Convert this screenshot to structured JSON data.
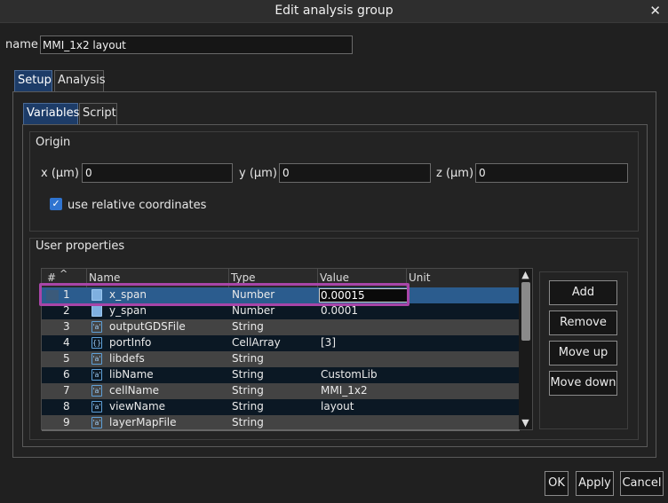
{
  "window": {
    "title": "Edit analysis group",
    "close_glyph": "✕"
  },
  "name_field": {
    "label": "name",
    "value": "MMI_1x2 layout"
  },
  "outer_tabs": [
    {
      "label": "Setup",
      "active": true
    },
    {
      "label": "Analysis",
      "active": false
    }
  ],
  "inner_tabs": [
    {
      "label": "Variables",
      "active": true
    },
    {
      "label": "Script",
      "active": false
    }
  ],
  "origin": {
    "title": "Origin",
    "x_label": "x (µm)",
    "x_value": "0",
    "y_label": "y (µm)",
    "y_value": "0",
    "z_label": "z (µm)",
    "z_value": "0",
    "relative_label": "use relative coordinates",
    "relative_checked": true
  },
  "user_properties": {
    "title": "User properties",
    "columns": {
      "num": "#",
      "name": "Name",
      "type": "Type",
      "value": "Value",
      "unit": "Unit"
    },
    "rows": [
      {
        "num": "1",
        "icon": "number-icon",
        "name": "x_span",
        "type": "Number",
        "value": "0.00015",
        "selected": true,
        "editing": true
      },
      {
        "num": "2",
        "icon": "number-icon",
        "name": "y_span",
        "type": "Number",
        "value": "0.0001"
      },
      {
        "num": "3",
        "icon": "string-icon",
        "name": "outputGDSFile",
        "type": "String",
        "value": ""
      },
      {
        "num": "4",
        "icon": "cellarray-icon",
        "name": "portInfo",
        "type": "CellArray",
        "value": "[3]"
      },
      {
        "num": "5",
        "icon": "string-icon",
        "name": "libdefs",
        "type": "String",
        "value": ""
      },
      {
        "num": "6",
        "icon": "string-icon",
        "name": "libName",
        "type": "String",
        "value": "CustomLib"
      },
      {
        "num": "7",
        "icon": "string-icon",
        "name": "cellName",
        "type": "String",
        "value": "MMI_1x2"
      },
      {
        "num": "8",
        "icon": "string-icon",
        "name": "viewName",
        "type": "String",
        "value": "layout"
      },
      {
        "num": "9",
        "icon": "string-icon",
        "name": "layerMapFile",
        "type": "String",
        "value": ""
      }
    ],
    "buttons": {
      "add": "Add",
      "remove": "Remove",
      "move_up": "Move up",
      "move_down": "Move down"
    }
  },
  "footer": {
    "ok": "OK",
    "apply": "Apply",
    "cancel": "Cancel"
  },
  "colors": {
    "selected_row": "#2b5c8e",
    "highlight": "#a845a8",
    "active_tab": "#1d3c68"
  }
}
